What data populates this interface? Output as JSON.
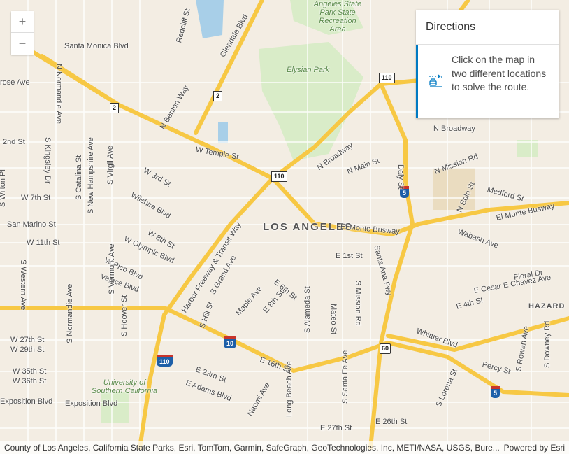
{
  "zoom": {
    "in_label": "+",
    "out_label": "−"
  },
  "directions": {
    "title": "Directions",
    "message": "Click on the map in two different locations to solve the route.",
    "icon": "route-car-icon",
    "accent": "#007ac2"
  },
  "attribution": {
    "text": "County of Los Angeles, California State Parks, Esri, TomTom, Garmin, SafeGraph, GeoTechnologies, Inc, METI/NASA, USGS, Bure...",
    "powered": "Powered by Esri"
  },
  "map": {
    "city": "LOS ANGELES",
    "parks": [
      "Elysian Park",
      "Angeles State Park State Recreation Area",
      "University of Southern California"
    ],
    "neighborhood": "HAZARD",
    "shields": [
      "2",
      "2",
      "110",
      "110",
      "5",
      "5",
      "10",
      "110",
      "60"
    ],
    "labels": [
      "Santa Monica Blvd",
      "rose Ave",
      "N Normandie Ave",
      "2nd St",
      "S Kingsley Dr",
      "S Wilton Pl",
      "W 7th St",
      "San Marino St",
      "W 11th St",
      "S Western Ave",
      "W 27th St",
      "W 29th St",
      "W 35th St",
      "W 36th St",
      "Exposition Blvd",
      "Exposition Blvd",
      "W Temple St",
      "Wilshire Blvd",
      "W 3rd St",
      "W Olympic Blvd",
      "W Pico Blvd",
      "Venice Blvd",
      "N Broadway",
      "N Broadway",
      "N Mission Rd",
      "Medford St",
      "El Monte Busway",
      "El Monte Busway",
      "Wabash Ave",
      "E Cesar E Chavez Ave",
      "E 4th St",
      "Whittier Blvd",
      "Percy St",
      "Floral Dr",
      "E 1st St",
      "E 6th St",
      "E 16th St",
      "E 23rd St",
      "E Adams Blvd",
      "E 26th St",
      "E 27th St",
      "S Grand Ave",
      "Maple Ave",
      "E 8th St",
      "Mateo St",
      "S Alameda St",
      "Long Beach Ave",
      "Naomi Ave",
      "S Santa Fe Ave",
      "S Mission Rd",
      "S Lorena St",
      "S Rowan Ave",
      "S Downey Rd",
      "Daly St",
      "N Main St",
      "N Benton Way",
      "Redcliff St",
      "S Virgil Ave",
      "S Vermont Ave",
      "S Hoover St",
      "S Normandie Ave",
      "S New Hampshire Ave",
      "S Catalina St",
      "Harbor Freeway & Transit Way",
      "Santa Ana Fwy",
      "W 8th St",
      "N Solo St",
      "Glendale Blvd",
      "S Hill St"
    ]
  }
}
